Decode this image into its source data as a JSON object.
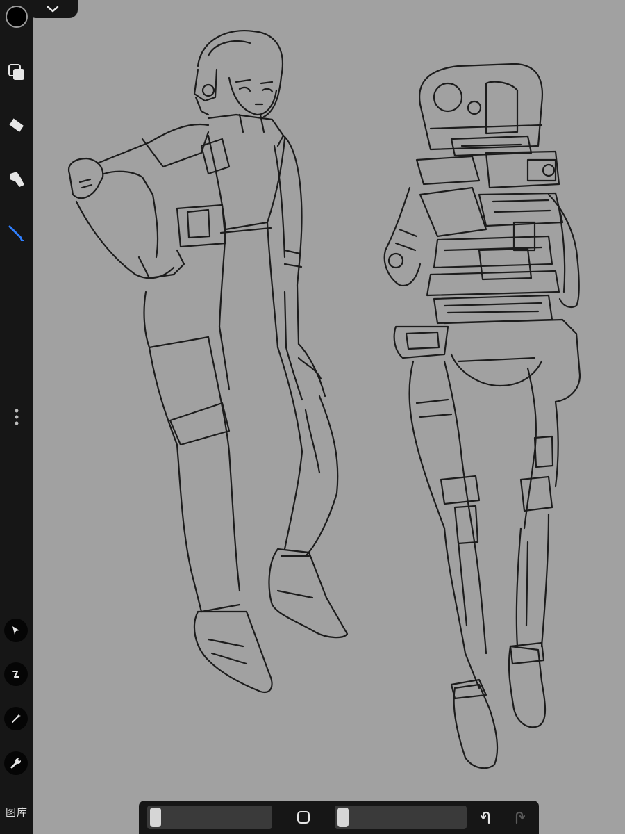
{
  "app": {
    "gallery_label": "图库"
  },
  "colors": {
    "sidebar_bg": "#161616",
    "canvas_bg": "#a1a1a1",
    "active_tool_accent": "#2f7fff",
    "current_brush_color": "#000000"
  },
  "sidebar": {
    "tools": [
      {
        "icon": "layers-icon",
        "active": false
      },
      {
        "icon": "eraser-icon",
        "active": false
      },
      {
        "icon": "smudge-icon",
        "active": false
      },
      {
        "icon": "brush-icon",
        "active": true
      }
    ],
    "bottom_tools": [
      {
        "icon": "selection-arrow-icon"
      },
      {
        "icon": "transform-icon"
      },
      {
        "icon": "magic-wand-icon"
      },
      {
        "icon": "wrench-icon"
      }
    ]
  },
  "bottom_bar": {
    "brush_size_slider": {
      "value": 0.05
    },
    "opacity_slider": {
      "value": 0.05
    },
    "undo_icon": "undo-icon",
    "redo_icon": "redo-icon",
    "modify_icon": "square-modify-icon"
  }
}
